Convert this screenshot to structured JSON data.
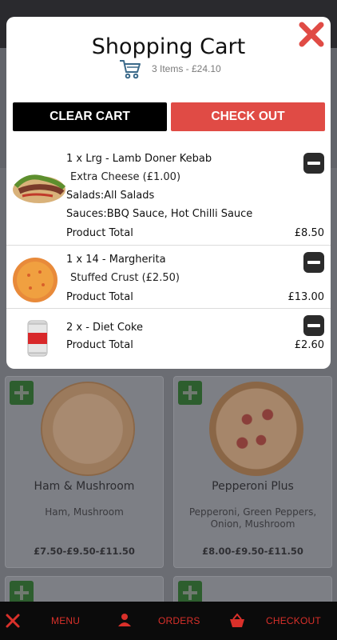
{
  "modal": {
    "title": "Shopping Cart",
    "summary": "3 Items - £24.10",
    "clear_label": "CLEAR CART",
    "checkout_label": "CHECK OUT"
  },
  "items": [
    {
      "title": "1 x Lrg - Lamb Doner Kebab",
      "extra": "Extra Cheese (£1.00)",
      "salads_label": "Salads:",
      "salads_value": "All Salads",
      "sauces_label": "Sauces:",
      "sauces_value": "BBQ Sauce, Hot Chilli Sauce",
      "total_label": "Product Total",
      "total_value": "£8.50"
    },
    {
      "title": "1 x 14 - Margherita",
      "extra": "Stuffed Crust (£2.50)",
      "total_label": "Product Total",
      "total_value": "£13.00"
    },
    {
      "title": "2 x - Diet Coke",
      "total_label": "Product Total",
      "total_value": "£2.60"
    }
  ],
  "products": [
    {
      "name": "Ham & Mushroom",
      "desc": "Ham, Mushroom",
      "price": "£7.50-£9.50-£11.50"
    },
    {
      "name": "Pepperoni Plus",
      "desc": "Pepperoni, Green Peppers, Onion, Mushroom",
      "price": "£8.00-£9.50-£11.50"
    }
  ],
  "nav": {
    "menu": "MENU",
    "orders": "ORDERS",
    "checkout": "CHECKOUT"
  },
  "colors": {
    "accent": "#e04b45",
    "nav_text": "#d9302a",
    "close": "#e04b45"
  }
}
